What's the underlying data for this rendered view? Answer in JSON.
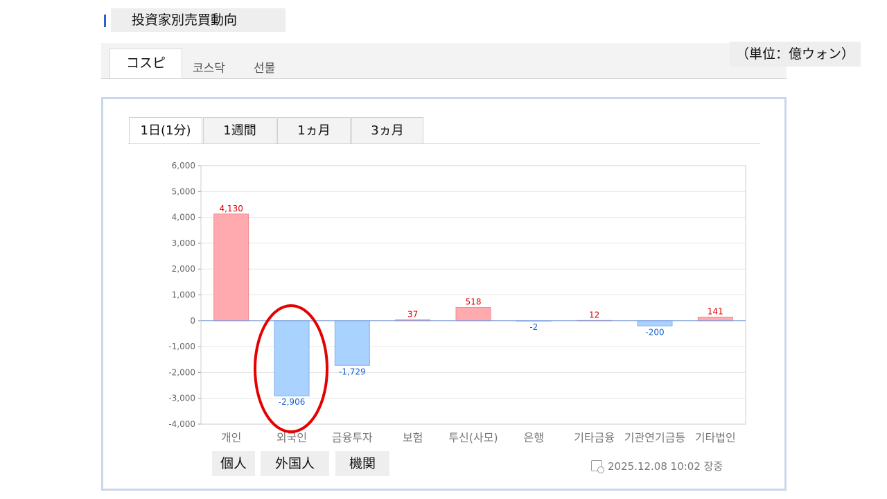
{
  "header": {
    "title": "投資家別売買動向",
    "unit_note": "（単位：億ウォン）"
  },
  "market_tabs": [
    {
      "label": "コスピ",
      "active": true
    },
    {
      "label": "코스닥",
      "active": false
    },
    {
      "label": "선물",
      "active": false
    }
  ],
  "period_tabs": [
    {
      "label": "1日(1分)",
      "active": true
    },
    {
      "label": "1週間",
      "active": false
    },
    {
      "label": "1ヵ月",
      "active": false
    },
    {
      "label": "3ヵ月",
      "active": false
    }
  ],
  "investor_labels": [
    "個人",
    "外国人",
    "機関"
  ],
  "timestamp": "2025.12.08 10:02 장중",
  "colors": {
    "positive_fill": "#ffaaaf",
    "positive_text": "#e00000",
    "negative_fill": "#aad2ff",
    "negative_text": "#1560d8",
    "highlight": "#e60000"
  },
  "chart_data": {
    "type": "bar",
    "categories": [
      "개인",
      "외국인",
      "금융투자",
      "보험",
      "투신(사모)",
      "은행",
      "기타금융",
      "기관연기금등",
      "기타법인"
    ],
    "values": [
      4130,
      -2906,
      -1729,
      37,
      518,
      -2,
      12,
      -200,
      141
    ],
    "value_labels": [
      "4,130",
      "-2,906",
      "-1,729",
      "37",
      "518",
      "-2",
      "12",
      "-200",
      "141"
    ],
    "ylim": [
      -4000,
      6000
    ],
    "yticks": [
      6000,
      5000,
      4000,
      3000,
      2000,
      1000,
      0,
      -1000,
      -2000,
      -3000,
      -4000
    ],
    "ytick_labels": [
      "6,000",
      "5,000",
      "4,000",
      "3,000",
      "2,000",
      "1,000",
      "0",
      "-1,000",
      "-2,000",
      "-3,000",
      "-4,000"
    ],
    "grid": true,
    "highlighted_category": "외국인"
  }
}
